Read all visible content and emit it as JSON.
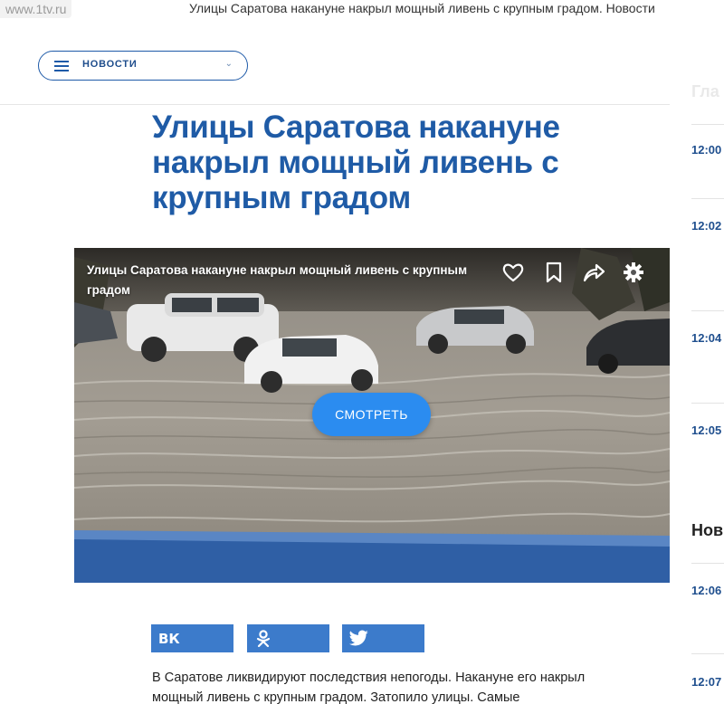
{
  "browser": {
    "url": "www.1tv.ru",
    "title": "Улицы Саратова накануне накрыл мощный ливень с крупным градом. Новости"
  },
  "nav": {
    "label": "НОВОСТИ"
  },
  "article": {
    "headline": "Улицы Саратова накануне накрыл мощный ливень с крупным градом",
    "body": "В Саратове ликвидируют последствия непогоды. Накануне его накрыл мощный ливень с крупным градом. Затопило улицы. Самые"
  },
  "video": {
    "title": "Улицы Саратова накануне накрыл мощный ливень с крупным градом",
    "watch_label": "СМОТРЕТЬ"
  },
  "share": {
    "vk_icon": "vk-icon",
    "ok_icon": "odnoklassniki-icon",
    "twitter_icon": "twitter-icon",
    "color": "#3c7bcb"
  },
  "sidebar": {
    "heading_main": "Гла",
    "heading_news": "Нов",
    "times_main": [
      "12:00",
      "12:02",
      "12:04",
      "12:05"
    ],
    "times_news": [
      "12:06",
      "12:07"
    ]
  },
  "colors": {
    "accent": "#1f5ba6",
    "button": "#2b8cf0"
  }
}
